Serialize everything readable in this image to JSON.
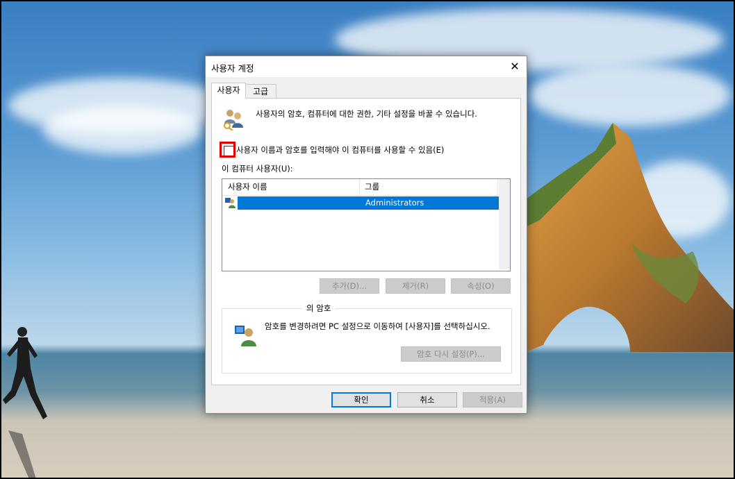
{
  "dialog": {
    "title": "사용자 계정",
    "close_glyph": "✕"
  },
  "tabs": [
    {
      "label": "사용자",
      "active": true
    },
    {
      "label": "고급",
      "active": false
    }
  ],
  "info_text": "사용자의 암호, 컴퓨터에 대한 권한, 기타 설정을 바꿀 수 있습니다.",
  "checkbox": {
    "label": "사용자 이름과 암호를 입력해야 이 컴퓨터를 사용할 수 있음(E)",
    "checked": false,
    "highlight_color": "#e00000"
  },
  "users_label": "이 컴퓨터 사용자(U):",
  "user_list": {
    "columns": [
      "사용자 이름",
      "그룹"
    ],
    "rows": [
      {
        "name": "",
        "group": "Administrators",
        "selected": true
      }
    ]
  },
  "list_buttons": {
    "add": "추가(D)...",
    "remove": "제거(R)",
    "properties": "속성(O)"
  },
  "password_group": {
    "legend": "의 암호",
    "text": "암호를 변경하려면 PC 설정으로 이동하여 [사용자]를 선택하십시오.",
    "reset_button": "암호 다시 설정(P)..."
  },
  "footer_buttons": {
    "ok": "확인",
    "cancel": "취소",
    "apply": "적용(A)"
  },
  "colors": {
    "accent": "#0078d7",
    "selection": "#0078d7"
  }
}
